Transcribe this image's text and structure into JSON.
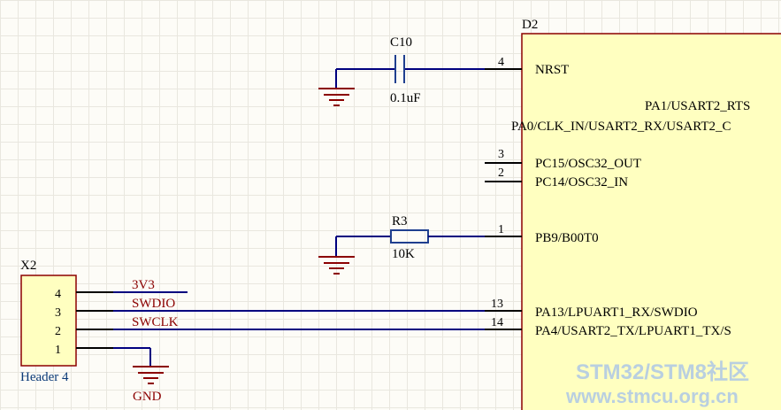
{
  "ic": {
    "designator": "D2",
    "pins": [
      {
        "num": "4",
        "name": "NRST"
      },
      {
        "num": "",
        "name": "PA1/USART2_RTS"
      },
      {
        "num": "",
        "name": "PA0/CLK_IN/USART2_RX/USART2_C"
      },
      {
        "num": "3",
        "name": "PC15/OSC32_OUT"
      },
      {
        "num": "2",
        "name": "PC14/OSC32_IN"
      },
      {
        "num": "1",
        "name": "PB9/B00T0"
      },
      {
        "num": "13",
        "name": "PA13/LPUART1_RX/SWDIO"
      },
      {
        "num": "14",
        "name": "PA4/USART2_TX/LPUART1_TX/S"
      }
    ]
  },
  "capacitor": {
    "designator": "C10",
    "value": "0.1uF"
  },
  "resistor": {
    "designator": "R3",
    "value": "10K"
  },
  "header": {
    "designator": "X2",
    "name": "Header 4",
    "pins": [
      "4",
      "3",
      "2",
      "1"
    ]
  },
  "nets": {
    "v": "3V3",
    "swdio": "SWDIO",
    "swclk": "SWCLK",
    "gnd": "GND"
  },
  "watermark": {
    "line1": "STM32/STM8社区",
    "line2": "www.stmcu.org.cn"
  },
  "colors": {
    "wire": "#00007f",
    "net_label": "#8b0000",
    "component": "#1f3f8f",
    "ic_body": "#ffffc0",
    "header_body": "#ffffc0"
  }
}
